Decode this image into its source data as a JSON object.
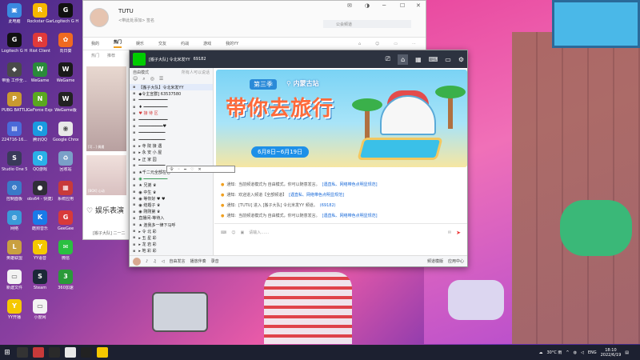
{
  "desktop": {
    "icons": [
      {
        "label": "此电脑",
        "icon": "computer-icon",
        "color": "#3a8ae0",
        "text": "▣"
      },
      {
        "label": "Rockstar Games",
        "icon": "rockstar-icon",
        "color": "#f5b800",
        "text": "R"
      },
      {
        "label": "Logitech G HUB",
        "icon": "logitech-icon",
        "color": "#111111",
        "text": "G"
      },
      {
        "label": "Logitech G HUB",
        "icon": "logitech-icon",
        "color": "#111111",
        "text": "G"
      },
      {
        "label": "Riot Client",
        "icon": "riot-icon",
        "color": "#e03a3a",
        "text": "R"
      },
      {
        "label": "向日葵",
        "icon": "sunflower-icon",
        "color": "#f06a20",
        "text": "✿"
      },
      {
        "label": "带鱼 工作全...",
        "icon": "tool-icon",
        "color": "#4a4a4a",
        "text": "◆"
      },
      {
        "label": "WeGame",
        "icon": "wegame-icon",
        "color": "#2a8a3a",
        "text": "W"
      },
      {
        "label": "WeGame",
        "icon": "wegame-icon",
        "color": "#1a1a1a",
        "text": "W"
      },
      {
        "label": "PUBG BATTLEG...",
        "icon": "pubg-icon",
        "color": "#c99a30",
        "text": "P"
      },
      {
        "label": "GeForce Experience",
        "icon": "geforce-icon",
        "color": "#5aa820",
        "text": "N"
      },
      {
        "label": "WeGame版",
        "icon": "wegame-icon",
        "color": "#222222",
        "text": "W"
      },
      {
        "label": "224716-16...",
        "icon": "file-icon",
        "color": "#4a6ad8",
        "text": "▤"
      },
      {
        "label": "腾讯QQ",
        "icon": "qq-icon",
        "color": "#1a9ae0",
        "text": "Q"
      },
      {
        "label": "Google Chrome",
        "icon": "chrome-icon",
        "color": "#e8e8e8",
        "text": "◉"
      },
      {
        "label": "Studio One 5",
        "icon": "studio-icon",
        "color": "#3a3a5a",
        "text": "S"
      },
      {
        "label": "QQ游戏",
        "icon": "qqgame-icon",
        "color": "#2ab0e8",
        "text": "Q"
      },
      {
        "label": "回收站",
        "icon": "recycle-bin-icon",
        "color": "#7aa0c8",
        "text": "♻"
      },
      {
        "label": "控制面板",
        "icon": "control-panel-icon",
        "color": "#3a7ac8",
        "text": "⚙"
      },
      {
        "label": "obs64 - 快捷方式",
        "icon": "obs-icon",
        "color": "#302e38",
        "text": "●"
      },
      {
        "label": "系统应用",
        "icon": "app-icon",
        "color": "#c83a3a",
        "text": "▦"
      },
      {
        "label": "网络",
        "icon": "network-icon",
        "color": "#3a9ad8",
        "text": "◍"
      },
      {
        "label": "酷狗音乐",
        "icon": "kugou-icon",
        "color": "#1a7ae8",
        "text": "K"
      },
      {
        "label": "GeeGee",
        "icon": "app-icon",
        "color": "#d83a3a",
        "text": "G"
      },
      {
        "label": "英雄联盟",
        "icon": "lol-icon",
        "color": "#c9a040",
        "text": "L"
      },
      {
        "label": "YY语音",
        "icon": "yy-icon",
        "color": "#f5c800",
        "text": "Y"
      },
      {
        "label": "微信",
        "icon": "wechat-icon",
        "color": "#2ac040",
        "text": "✉"
      },
      {
        "label": "新建文件",
        "icon": "file-icon",
        "color": "#f3f3f3",
        "text": "▭"
      },
      {
        "label": "Steam",
        "icon": "steam-icon",
        "color": "#1b2838",
        "text": "S"
      },
      {
        "label": "360加速",
        "icon": "360-icon",
        "color": "#2a9a3a",
        "text": "3"
      },
      {
        "label": "YY开播",
        "icon": "yy-icon",
        "color": "#f5c800",
        "text": "Y"
      },
      {
        "label": "小度网",
        "icon": "file-icon",
        "color": "#f3f3f3",
        "text": "▭"
      }
    ]
  },
  "back_window": {
    "user_name": "TUTU",
    "user_sub": "<带此处添加> 签名",
    "search_placeholder": "公会频道",
    "tabs": [
      "我的",
      "热门",
      "娱乐",
      "交友",
      "约战",
      "游戏",
      "我的YY"
    ],
    "active_tab": "热门",
    "subtabs": [
      "热门",
      "推荐"
    ],
    "thumb_caption_1": "[可...] 偶遇",
    "thumb_caption_2": "[BOX] 心动",
    "ent_text": "娱乐表演",
    "bottom_caption": "[搬子大队] 二一二"
  },
  "front_window": {
    "title": "[搬子大队] 令北米发YY",
    "id": "69182",
    "left_mode": "自由模式",
    "left_mode_right": "所有人可以说话",
    "channels": [
      {
        "text": "【搬子大队】令北米发YY",
        "cls": "hl"
      },
      {
        "text": "◆令主宣群]        63537580",
        "cls": ""
      },
      {
        "text": "━━━━━━━━━━━━",
        "cls": ""
      },
      {
        "text": "♦ ━━━━━━━━━━",
        "cls": ""
      },
      {
        "text": "  ♥   接   待   区",
        "cls": "red"
      },
      {
        "text": "━━━━━━━━━━━━",
        "cls": ""
      },
      {
        "text": "  ━━━━━━━━━━♥",
        "cls": ""
      },
      {
        "text": "  ━━━━━━━━━━━",
        "cls": ""
      },
      {
        "text": "  ━━━━━━━━━━━",
        "cls": ""
      },
      {
        "text": "  ▸   寺   院   接   遇",
        "cls": ""
      },
      {
        "text": "  ▸   永   安   小   屋",
        "cls": ""
      },
      {
        "text": "  ▸   正   家   园",
        "cls": ""
      },
      {
        "text": "  ━━━━━━━━━━━",
        "cls": ""
      },
      {
        "text": "★千二元全部在它",
        "cls": ""
      },
      {
        "text": "◉ ━━━━━━━━━━",
        "cls": "green"
      },
      {
        "text": "  ★ 兄弟 ♛",
        "cls": ""
      },
      {
        "text": "  ◉ 中生  ♛",
        "cls": ""
      },
      {
        "text": "  ◉ 等你好   ♥ ♥",
        "cls": ""
      },
      {
        "text": "  ◉ 结婚子  ♛",
        "cls": ""
      },
      {
        "text": "  ◉ 刚刚第 ♛",
        "cls": ""
      },
      {
        "text": "直播间-等待入",
        "cls": ""
      },
      {
        "text": "★ 连我多一律下马呼",
        "cls": ""
      },
      {
        "text": "  ▸ 令   北   彩",
        "cls": ""
      },
      {
        "text": "  ▸ 五   星   彩",
        "cls": ""
      },
      {
        "text": "  ▸ 龙   岩   彩",
        "cls": ""
      },
      {
        "text": "  ▸ 地   彩   彩",
        "cls": ""
      }
    ],
    "banner": {
      "season": "第三季",
      "location": "内蒙古站",
      "headline": "带你去旅行",
      "date": "6月8日~6月19日"
    },
    "messages": [
      {
        "prefix": "通知:",
        "text": "当前频道模式为 自由模式，你可以随意发言。",
        "link": "[遇直私、网络带色点明显规范]"
      },
      {
        "prefix": "通知:",
        "text": "欢迎进入频道【全部频道】",
        "link": "[遇直私、网络带色点明显规范]"
      },
      {
        "prefix": "通知:",
        "text": "[TUTU] 进入 [搬子大队] 令北米发YY 频道。",
        "link": "(69182)"
      },
      {
        "prefix": "通知:",
        "text": "当前频道模式为 自由模式，你可以随意发言。",
        "link": "[遇直私、网络带色点明显规范]"
      }
    ],
    "input_placeholder": "请输入……",
    "bottom": {
      "mic_label": "自由发言",
      "play_label": "播放伴奏",
      "record_label": "录音",
      "right_1": "频道模版",
      "right_2": "应用中心"
    }
  },
  "popup_items": [
    "令",
    "◦",
    "━",
    "♡",
    "✕"
  ],
  "taskbar": {
    "weather": "30°C 雨",
    "lang": "ENG",
    "time": "18:10",
    "date": "2022/6/19"
  }
}
